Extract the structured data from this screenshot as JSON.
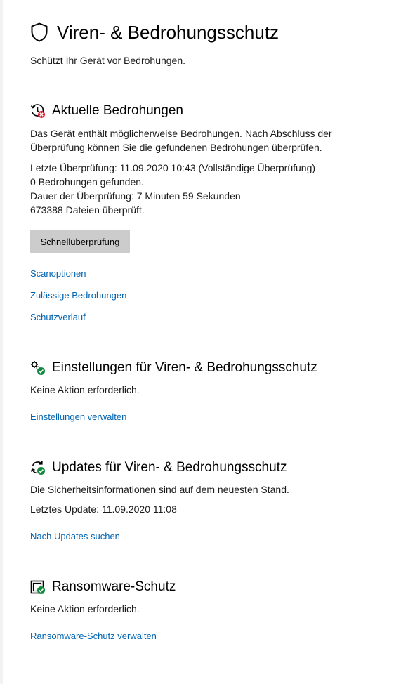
{
  "page": {
    "title": "Viren- & Bedrohungsschutz",
    "subtitle": "Schützt Ihr Gerät vor Bedrohungen.",
    "title_icon": "shield-icon"
  },
  "threats": {
    "icon": "clock-alert-icon",
    "title": "Aktuelle Bedrohungen",
    "description": "Das Gerät enthält möglicherweise Bedrohungen. Nach Abschluss der Überprüfung können Sie die gefundenen Bedrohungen überprüfen.",
    "last_scan": "Letzte Überprüfung: 11.09.2020 10:43 (Vollständige Überprüfung)",
    "threats_found": "0 Bedrohungen gefunden.",
    "duration": "Dauer der Überprüfung: 7 Minuten 59 Sekunden",
    "files_scanned": "673388 Dateien überprüft.",
    "quick_scan_label": "Schnellüberprüfung",
    "links": {
      "scan_options": "Scanoptionen",
      "allowed_threats": "Zulässige Bedrohungen",
      "protection_history": "Schutzverlauf"
    }
  },
  "settings": {
    "icon": "settings-check-icon",
    "title": "Einstellungen für Viren- & Bedrohungsschutz",
    "status": "Keine Aktion erforderlich.",
    "link": "Einstellungen verwalten"
  },
  "updates": {
    "icon": "update-check-icon",
    "title": "Updates für Viren- & Bedrohungsschutz",
    "status": "Die Sicherheitsinformationen sind auf dem neuesten Stand.",
    "last_update": "Letztes Update: 11.09.2020 11:08",
    "link": "Nach Updates suchen"
  },
  "ransomware": {
    "icon": "ransomware-folder-icon",
    "title": "Ransomware-Schutz",
    "status": "Keine Aktion erforderlich.",
    "link": "Ransomware-Schutz verwalten"
  },
  "colors": {
    "link": "#0063b1",
    "ok_green": "#10893e",
    "alert_red": "#e81123",
    "button_bg": "#cccccc"
  }
}
